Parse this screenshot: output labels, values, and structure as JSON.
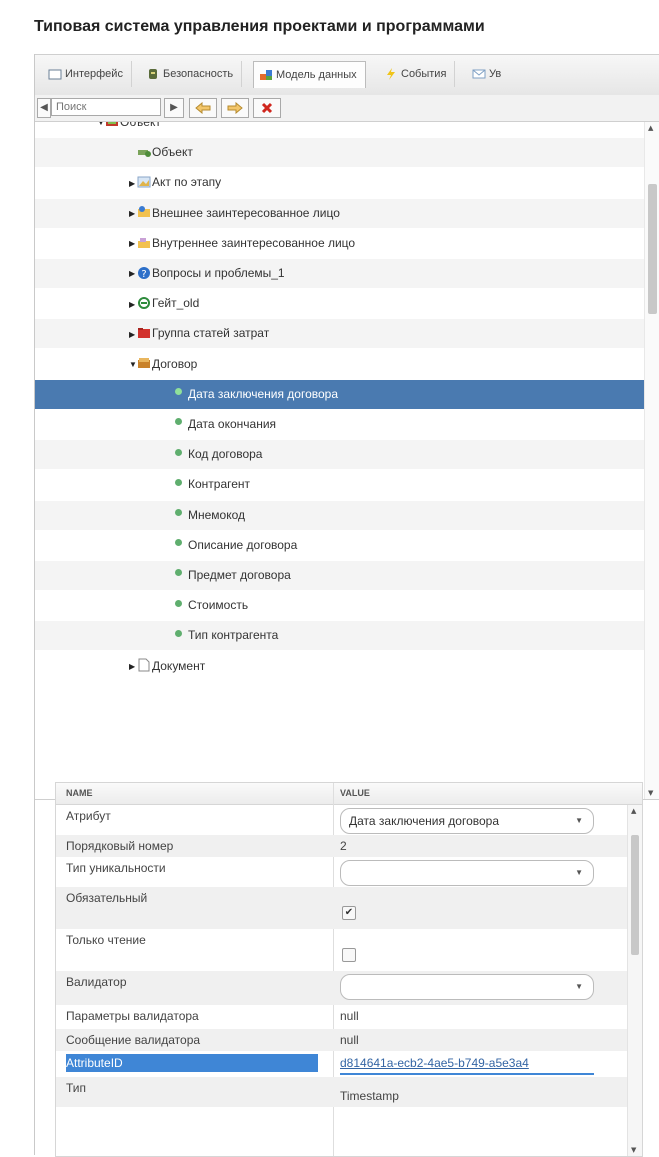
{
  "page": {
    "title": "Типовая система управления проектами и программами"
  },
  "tabs": [
    {
      "label": "Интерфейс",
      "icon": "window-icon",
      "active": false
    },
    {
      "label": "Безопасность",
      "icon": "shield-icon",
      "active": false
    },
    {
      "label": "Модель данных",
      "icon": "data-model-icon",
      "active": true
    },
    {
      "label": "События",
      "icon": "lightning-icon",
      "active": false
    },
    {
      "label": "Ув",
      "icon": "mail-icon",
      "active": false
    }
  ],
  "toolbar": {
    "search_placeholder": "Поиск"
  },
  "tree": {
    "rows": [
      {
        "label": "Объект",
        "level": 0,
        "arrow": "▼",
        "icon": "object-icon"
      },
      {
        "label": "Объект",
        "level": 1,
        "arrow": "",
        "icon": "object-green-icon"
      },
      {
        "label": "Акт по этапу",
        "level": 1,
        "arrow": "▶",
        "icon": "document-image-icon"
      },
      {
        "label": "Внешнее заинтересованное лицо",
        "level": 1,
        "arrow": "▶",
        "icon": "external-person-icon"
      },
      {
        "label": "Внутреннее заинтересованное лицо",
        "level": 1,
        "arrow": "▶",
        "icon": "internal-person-icon"
      },
      {
        "label": "Вопросы и проблемы_1",
        "level": 1,
        "arrow": "▶",
        "icon": "question-icon"
      },
      {
        "label": "Гейт_old",
        "level": 1,
        "arrow": "▶",
        "icon": "gate-icon"
      },
      {
        "label": "Группа статей затрат",
        "level": 1,
        "arrow": "▶",
        "icon": "folder-red-icon"
      },
      {
        "label": "Договор",
        "level": 1,
        "arrow": "▼",
        "icon": "contract-icon"
      },
      {
        "label": "Дата заключения договора",
        "level": 2,
        "arrow": "",
        "icon": "attribute-dot-icon",
        "selected": true
      },
      {
        "label": "Дата окончания",
        "level": 2,
        "arrow": "",
        "icon": "attribute-dot-icon"
      },
      {
        "label": "Код договора",
        "level": 2,
        "arrow": "",
        "icon": "attribute-dot-icon"
      },
      {
        "label": "Контрагент",
        "level": 2,
        "arrow": "",
        "icon": "attribute-dot-icon"
      },
      {
        "label": "Мнемокод",
        "level": 2,
        "arrow": "",
        "icon": "attribute-dot-icon"
      },
      {
        "label": "Описание договора",
        "level": 2,
        "arrow": "",
        "icon": "attribute-dot-icon"
      },
      {
        "label": "Предмет договора",
        "level": 2,
        "arrow": "",
        "icon": "attribute-dot-icon"
      },
      {
        "label": "Стоимость",
        "level": 2,
        "arrow": "",
        "icon": "attribute-dot-icon"
      },
      {
        "label": "Тип контрагента",
        "level": 2,
        "arrow": "",
        "icon": "attribute-dot-icon"
      },
      {
        "label": "Документ",
        "level": 1,
        "arrow": "▶",
        "icon": "document-icon"
      }
    ]
  },
  "grid": {
    "col_name": "NAME",
    "col_value": "VALUE",
    "rows": [
      {
        "name": "Атрибут",
        "value": "Дата заключения договора",
        "kind": "combo"
      },
      {
        "name": "Порядковый номер",
        "value": "2",
        "kind": "text"
      },
      {
        "name": "Тип уникальности",
        "value": "",
        "kind": "combo"
      },
      {
        "name": "Обязательный",
        "value": true,
        "kind": "checkbox"
      },
      {
        "name": "Только чтение",
        "value": false,
        "kind": "checkbox"
      },
      {
        "name": "Валидатор",
        "value": "",
        "kind": "combo"
      },
      {
        "name": "Параметры валидатора",
        "value": "null",
        "kind": "text"
      },
      {
        "name": "Сообщение валидатора",
        "value": "null",
        "kind": "text"
      },
      {
        "name": "AttributeID",
        "value": "d814641a-ecb2-4ae5-b749-a5e3a4",
        "kind": "link",
        "highlighted": true
      },
      {
        "name": "Тип",
        "value": "Timestamp",
        "kind": "text"
      }
    ]
  }
}
